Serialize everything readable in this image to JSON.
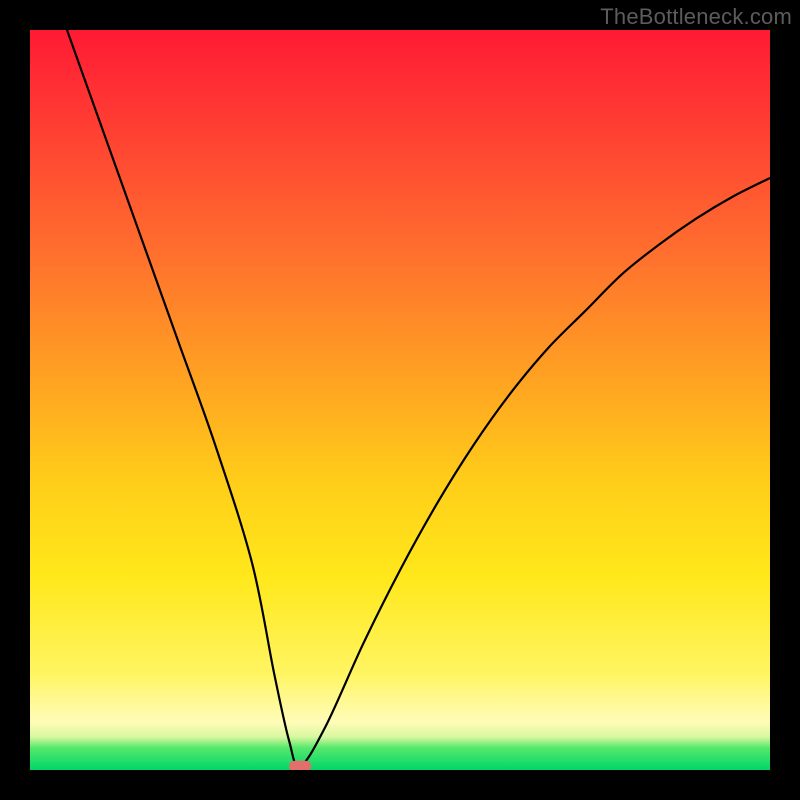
{
  "watermark": "TheBottleneck.com",
  "chart_data": {
    "type": "line",
    "title": "",
    "xlabel": "",
    "ylabel": "",
    "xlim": [
      0,
      100
    ],
    "ylim": [
      0,
      100
    ],
    "grid": false,
    "legend": false,
    "background": "red-to-green vertical gradient (bottleneck severity scale)",
    "series": [
      {
        "name": "bottleneck-curve",
        "color": "#000000",
        "x": [
          5,
          10,
          15,
          20,
          25,
          30,
          33,
          35,
          36.5,
          40,
          45,
          50,
          55,
          60,
          65,
          70,
          75,
          80,
          85,
          90,
          95,
          100
        ],
        "values": [
          100,
          86,
          72,
          58,
          44,
          28,
          13,
          4,
          0.5,
          6,
          17,
          27,
          36,
          44,
          51,
          57,
          62,
          67,
          71,
          74.5,
          77.5,
          80
        ]
      }
    ],
    "marker": {
      "name": "optimal-point",
      "x": 36.5,
      "y": 0.5,
      "color": "#e36f6a",
      "shape": "pill"
    }
  }
}
